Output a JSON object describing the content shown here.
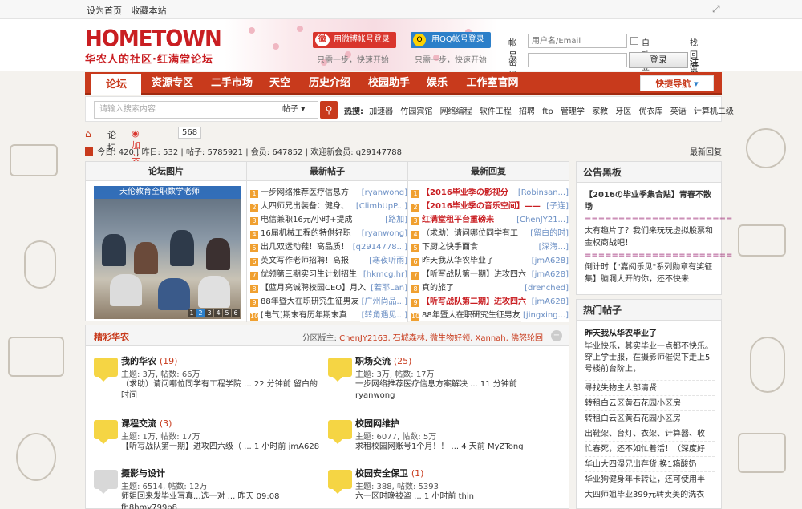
{
  "topbar": {
    "set_home": "设为首页",
    "bookmark": "收藏本站"
  },
  "logo": {
    "main": "HOMETOWN",
    "sub": "华农人的社区·红满堂论坛"
  },
  "social": {
    "weibo_label": "用微博帐号登录",
    "weibo_sub": "只需一步，快速开始",
    "qq_label": "用QQ帐号登录",
    "qq_sub": "只需一步，快速开始"
  },
  "login": {
    "account_label": "帐号",
    "account_placeholder": "用户名/Email",
    "password_label": "密码",
    "auto_login": "自动登录",
    "retrieve_password": "找回密码",
    "login_button": "登录",
    "register": "注册"
  },
  "nav": {
    "items": [
      "论坛",
      "资源专区",
      "二手市场",
      "天空",
      "历史介绍",
      "校园助手",
      "娱乐",
      "工作室官网"
    ],
    "quick_nav": "快捷导航"
  },
  "search": {
    "placeholder": "请输入搜索内容",
    "scope": "帖子",
    "hot_label": "热搜:",
    "hot": [
      "加速器",
      "竹园宾馆",
      "网络编程",
      "软件工程",
      "招聘",
      "ftp",
      "管理学",
      "家教",
      "牙医",
      "优衣库",
      "英语",
      "计算机二级"
    ]
  },
  "breadcrumb": {
    "current": "论坛",
    "follow": "加关注",
    "follow_count": "568"
  },
  "stats": {
    "today": "今日: 420",
    "yesterday": "昨日: 532",
    "posts": "帖子: 5785921",
    "members": "会员: 647852",
    "welcome": "欢迎新会员: q29147788",
    "latest_reply": "最新回复"
  },
  "grid": {
    "col1": "论坛图片",
    "col2": "最新帖子",
    "col3": "最新回复",
    "pic_caption": "天伦教育全职数学老师",
    "pic_pages": [
      "1",
      "2",
      "3",
      "4",
      "5",
      "6"
    ],
    "new_posts": [
      {
        "n": "1",
        "title": "一步网络推荐医疗信息方",
        "author": "[ryanwong]"
      },
      {
        "n": "2",
        "title": "大四师兄出装备：健身、",
        "author": "[ClimbUpP...]"
      },
      {
        "n": "3",
        "title": "电信兼职16元/小时+提成",
        "author": "[路加]"
      },
      {
        "n": "4",
        "title": "16届机械工程的特供好职",
        "author": "[ryanwong]"
      },
      {
        "n": "5",
        "title": "出几双运动鞋！高品质！",
        "author": "[q2914778...]"
      },
      {
        "n": "6",
        "title": "英文写作老师招聘！高报",
        "author": "[寒夜听雨]"
      },
      {
        "n": "7",
        "title": "优领第三期实习生计划招生",
        "author": "[hkmcg.hr]"
      },
      {
        "n": "8",
        "title": "【蓝月亮诚聘校园CEO】月入",
        "author": "[若耶Lan]"
      },
      {
        "n": "9",
        "title": "88年暨大在职研究生征男友",
        "author": "[广州尚品...]"
      },
      {
        "n": "10",
        "title": "[电气]期末有历年期末真",
        "author": "[转角遇见...]"
      }
    ],
    "new_replies": [
      {
        "n": "1",
        "title": "【2016毕业季の影视分",
        "author": "[Robinsan...]",
        "red": true
      },
      {
        "n": "2",
        "title": "【2016毕业季の音乐空间】——",
        "author": "[子连]",
        "red": true
      },
      {
        "n": "3",
        "title": "红满堂租平台重磅来",
        "author": "[ChenJY21...]",
        "red": true
      },
      {
        "n": "4",
        "title": "（求助）请问哪位同学有工",
        "author": "[留白的时]",
        "red": false
      },
      {
        "n": "5",
        "title": "下厨之快手面食",
        "author": "[深海...]",
        "red": false
      },
      {
        "n": "6",
        "title": "昨天我从华农毕业了",
        "author": "[jmA628]",
        "red": false
      },
      {
        "n": "7",
        "title": "【听写战队第一期】进攻四六",
        "author": "[jmA628]",
        "red": false
      },
      {
        "n": "8",
        "title": "真的旅了",
        "author": "[drenched]",
        "red": false
      },
      {
        "n": "9",
        "title": "【听写战队第二期】进攻四六",
        "author": "[jmA628]",
        "red": true
      },
      {
        "n": "10",
        "title": "88年暨大在职研究生征男友",
        "author": "[jingxing...]",
        "red": false
      }
    ]
  },
  "section": {
    "title": "精彩华农",
    "mods_label": "分区版主:",
    "mods": "ChenJY2163, 石城森林, 微生物好领, Xannah, 佛怒轮回",
    "forums": [
      {
        "name": "我的华农",
        "count": "(19)",
        "stats": "主题: 3万, 帖数: 66万",
        "last": "（求助）请问哪位同学有工程学院 ... 22 分钟前 留白的时间"
      },
      {
        "name": "职场交流",
        "count": "(25)",
        "stats": "主题: 3万, 帖数: 17万",
        "last": "一步网络推荐医疗信息方案解决 ... 11 分钟前 ryanwong"
      },
      {
        "name": "课程交流",
        "count": "(3)",
        "stats": "主题: 1万, 帖数: 17万",
        "last": "【听写战队第一期】进攻四六级（ ... 1 小时前 jmA628"
      },
      {
        "name": "校园网维护",
        "count": "",
        "stats": "主题: 6077, 帖数: 5万",
        "last": "求租校园网账号1个月！！ ... 4 天前 MyZTong"
      },
      {
        "name": "摄影与设计",
        "count": "",
        "stats": "主题: 6514, 帖数: 12万",
        "last": "师姐回来发毕业写真...选一对 ... 昨天 09:08 fh8hmy799b8"
      },
      {
        "name": "校园安全保卫",
        "count": "(1)",
        "stats": "主题: 388, 帖数: 5393",
        "last": "六一区时晚被盗 ... 1 小时前 thin"
      }
    ]
  },
  "notice": {
    "title": "公告黑板",
    "line1": "【2016の毕业季集合贴】青春不散场",
    "sep": "======================",
    "line2": "太有趣片了？我们来玩玩虚拟股票和金权商战吧！",
    "line3": "倒计时【\"嘉阅乐见\"系列勋章有奖征集】脑洞大开的你，还不快来"
  },
  "hot": {
    "title": "热门帖子",
    "first": "昨天我从华农毕业了",
    "first_desc": "毕业快乐，其实毕业一点都不快乐。穿上学士服，在摄影师催促下走上5号楼前台阶上，",
    "items": [
      "寻找失物主人部清贤",
      "转租白云区黄石花园小区房",
      "转租白云区黄石花园小区房",
      "出鞋架、台灯、衣架、计算器、收",
      "忙春死，还不如忙着活！（深度好",
      "华山大四湿兄出存货,换1箱酸奶",
      "华业狗健身年卡转让，还可使用半",
      "大四师姐毕业399元转卖美的洗衣"
    ]
  }
}
